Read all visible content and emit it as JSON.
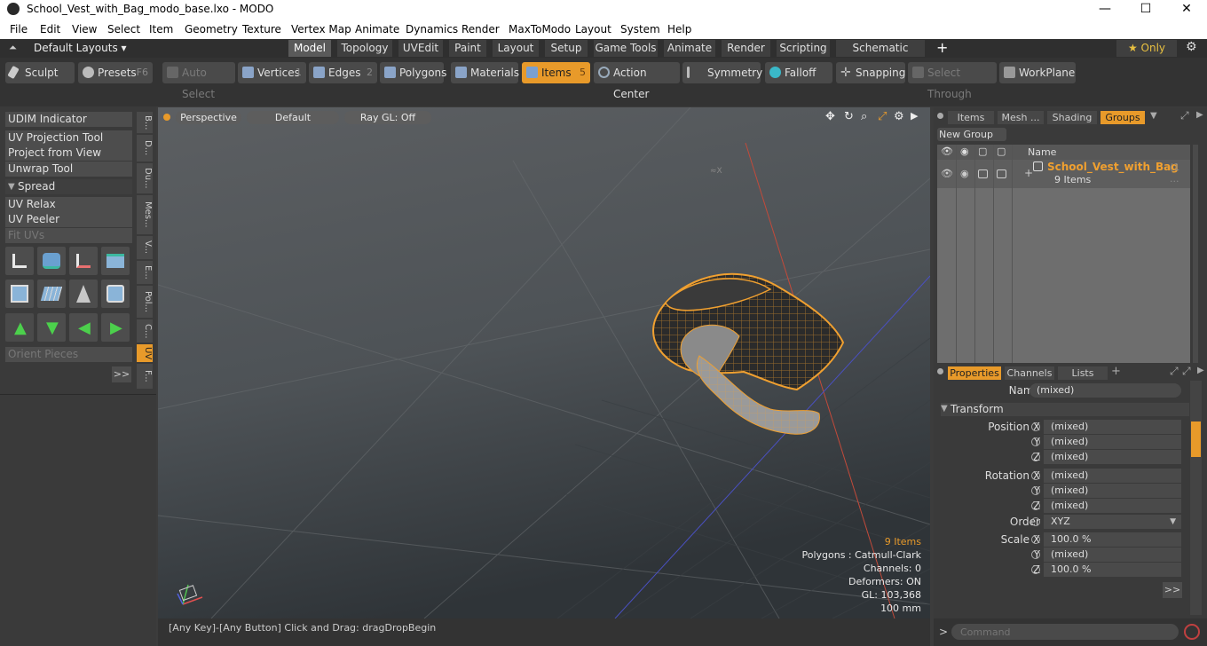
{
  "window": {
    "title": "School_Vest_with_Bag_modo_base.lxo - MODO",
    "minimize": "—",
    "maximize": "☐",
    "close": "✕"
  },
  "menu": [
    "File",
    "Edit",
    "View",
    "Select",
    "Item",
    "Geometry",
    "Texture",
    "Vertex Map",
    "Animate",
    "Dynamics",
    "Render",
    "MaxToModo",
    "Layout",
    "System",
    "Help"
  ],
  "layout": {
    "name": "Default Layouts ▾",
    "tabs": [
      "Model",
      "Topology",
      "UVEdit",
      "Paint",
      "Layout",
      "Setup",
      "Game Tools",
      "Animate",
      "Render",
      "Scripting",
      "Schematic Fusion"
    ],
    "add": "+",
    "only": "★  Only"
  },
  "toolbar": {
    "sculpt": "Sculpt",
    "presets": "Presets",
    "presets_key": "F6",
    "auto_select": "Auto Select",
    "vertices": "Vertices",
    "vertices_key": "1",
    "edges": "Edges",
    "edges_key": "2",
    "polygons": "Polygons",
    "materials": "Materials",
    "items": "Items",
    "items_key": "5",
    "action_center": "Action Center",
    "symmetry": "Symmetry",
    "falloff": "Falloff",
    "snapping": "Snapping",
    "select_through": "Select Through",
    "workplane": "WorkPlane"
  },
  "left": {
    "udim": "UDIM Indicator",
    "uv_proj": "UV Projection Tool",
    "proj_view": "Project from View",
    "unwrap": "Unwrap Tool",
    "spread": "Spread",
    "uv_relax": "UV Relax",
    "uv_peeler": "UV Peeler",
    "fit_uvs": "Fit UVs",
    "orient": "Orient Pieces",
    "more": ">>",
    "vtabs": [
      "B...",
      "D...",
      "Du...",
      "Mes...",
      "V...",
      "E...",
      "Pol...",
      "C...",
      "UV",
      "F..."
    ]
  },
  "viewport": {
    "perspective": "Perspective",
    "default": "Default",
    "raygl": "Ray GL: Off",
    "info": {
      "items": "9 Items",
      "polygons": "Polygons : Catmull-Clark",
      "channels": "Channels: 0",
      "deformers": "Deformers: ON",
      "gl": "GL: 103,368",
      "scale": "100 mm"
    }
  },
  "status": {
    "text": "[Any Key]-[Any Button] Click and Drag:   dragDropBegin"
  },
  "groups": {
    "tabs": [
      "Items",
      "Mesh ...",
      "Shading",
      "Groups"
    ],
    "new_group": "New Group",
    "col_name": "Name",
    "item_name": "School_Vest_with_Bag",
    "item_extra": "(1 ...",
    "item_count": "9 Items"
  },
  "props": {
    "tabs": [
      "Properties",
      "Channels",
      "Lists"
    ],
    "add": "+",
    "name_label": "Name",
    "name_val": "(mixed)",
    "transform": "Transform",
    "pos_label": "Position X",
    "rot_label": "Rotation X",
    "scale_label": "Scale X",
    "order_label": "Order",
    "order_val": "XYZ",
    "y": "Y",
    "z": "Z",
    "mixed": "(mixed)",
    "pct": "100.0 %",
    "more": ">>"
  },
  "command": {
    "placeholder": "Command",
    "prompt": ">"
  },
  "colors": {
    "accent": "#e89a2a",
    "wire": "#f0a030"
  }
}
